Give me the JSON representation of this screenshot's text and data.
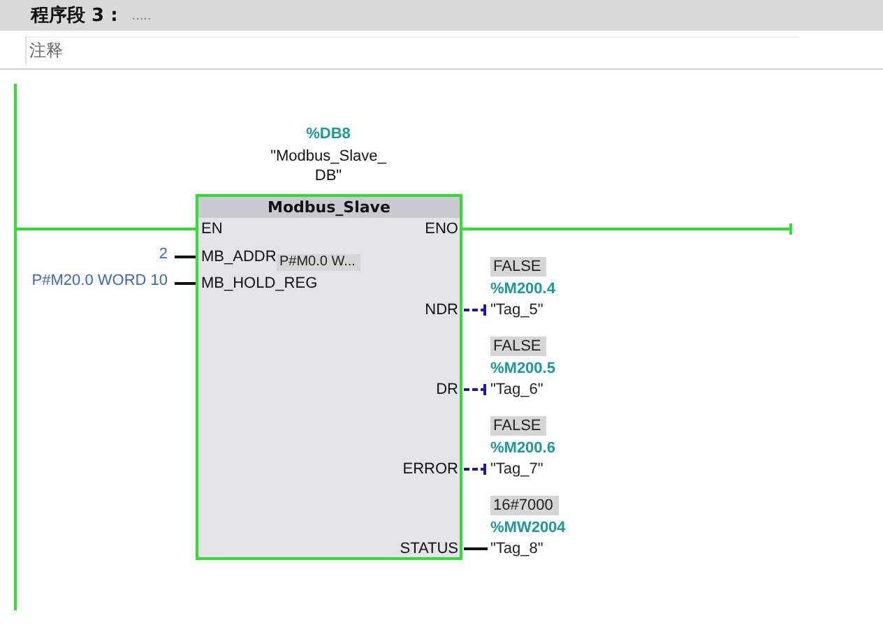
{
  "network": {
    "title": "程序段 3 :",
    "title_placeholder": ".....",
    "comment_placeholder": "注释"
  },
  "block": {
    "instance_address": "%DB8",
    "instance_name_lines": [
      "\"Modbus_Slave_",
      "DB\""
    ],
    "name": "Modbus_Slave",
    "inputs": [
      {
        "pin": "EN",
        "kind": "power"
      },
      {
        "pin": "MB_ADDR",
        "kind": "operand",
        "operand": "2",
        "monitor": "P#M0.0 W..."
      },
      {
        "pin": "MB_HOLD_REG",
        "kind": "operand",
        "operand": "P#M20.0 WORD 10"
      }
    ],
    "outputs": [
      {
        "pin": "ENO",
        "kind": "power"
      },
      {
        "pin": "NDR",
        "kind": "bool",
        "monitor": "FALSE",
        "address": "%M200.4",
        "tag": "\"Tag_5\""
      },
      {
        "pin": "DR",
        "kind": "bool",
        "monitor": "FALSE",
        "address": "%M200.5",
        "tag": "\"Tag_6\""
      },
      {
        "pin": "ERROR",
        "kind": "bool",
        "monitor": "FALSE",
        "address": "%M200.6",
        "tag": "\"Tag_7\""
      },
      {
        "pin": "STATUS",
        "kind": "word",
        "monitor": "16#7000",
        "address": "%MW2004",
        "tag": "\"Tag_8\""
      }
    ]
  }
}
